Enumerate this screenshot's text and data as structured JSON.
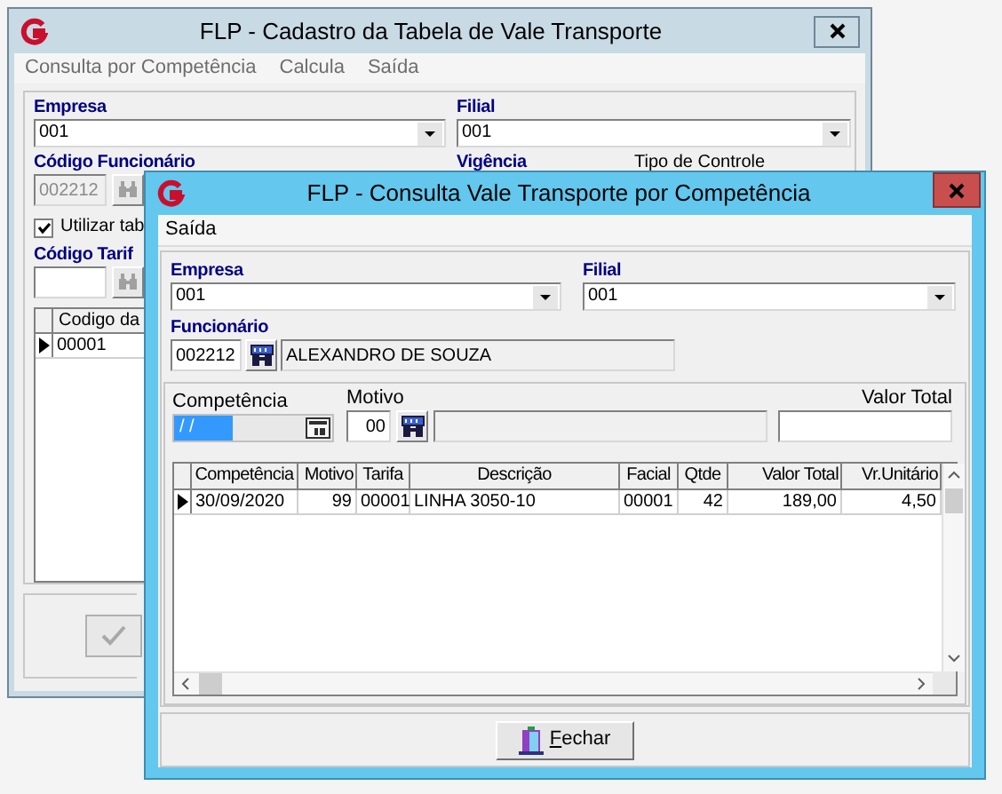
{
  "background_window": {
    "title": "FLP - Cadastro da Tabela de Vale Transporte",
    "menu": [
      "Consulta por Competência",
      "Calcula",
      "Saída"
    ],
    "empresa": {
      "label": "Empresa",
      "value": "001"
    },
    "filial": {
      "label": "Filial",
      "value": "001"
    },
    "codigo_funcionario": {
      "label": "Código Funcionário",
      "value": "002212"
    },
    "vigencia_label": "Vigência",
    "tipo_controle_label": "Tipo de Controle",
    "utilizar_tabela": {
      "label": "Utilizar tab",
      "checked": true
    },
    "codigo_tarifa": {
      "label": "Código Tarif"
    },
    "grid": {
      "columns": [
        "Codigo da"
      ],
      "rows": [
        {
          "cells": [
            "00001"
          ],
          "selected": true
        }
      ]
    }
  },
  "front_window": {
    "title": "FLP - Consulta Vale Transporte por Competência",
    "menu": [
      "Saída"
    ],
    "empresa": {
      "label": "Empresa",
      "value": "001"
    },
    "filial": {
      "label": "Filial",
      "value": "001"
    },
    "funcionario": {
      "label": "Funcionário",
      "code": "002212",
      "name": "ALEXANDRO DE SOUZA"
    },
    "competencia": {
      "label": "Competência",
      "value": "/ /"
    },
    "motivo": {
      "label": "Motivo",
      "value": "00"
    },
    "valor_total": {
      "label": "Valor Total"
    },
    "grid": {
      "columns": [
        "Competência",
        "Motivo",
        "Tarifa",
        "Descrição",
        "Facial",
        "Qtde",
        "Valor Total",
        "Vr.Unitário"
      ],
      "rows": [
        {
          "cells": [
            "30/09/2020",
            "99",
            "00001",
            "LINHA 3050-10",
            "00001",
            "42",
            "189,00",
            "4,50"
          ],
          "selected": true
        }
      ]
    },
    "close_button": "Fechar"
  }
}
